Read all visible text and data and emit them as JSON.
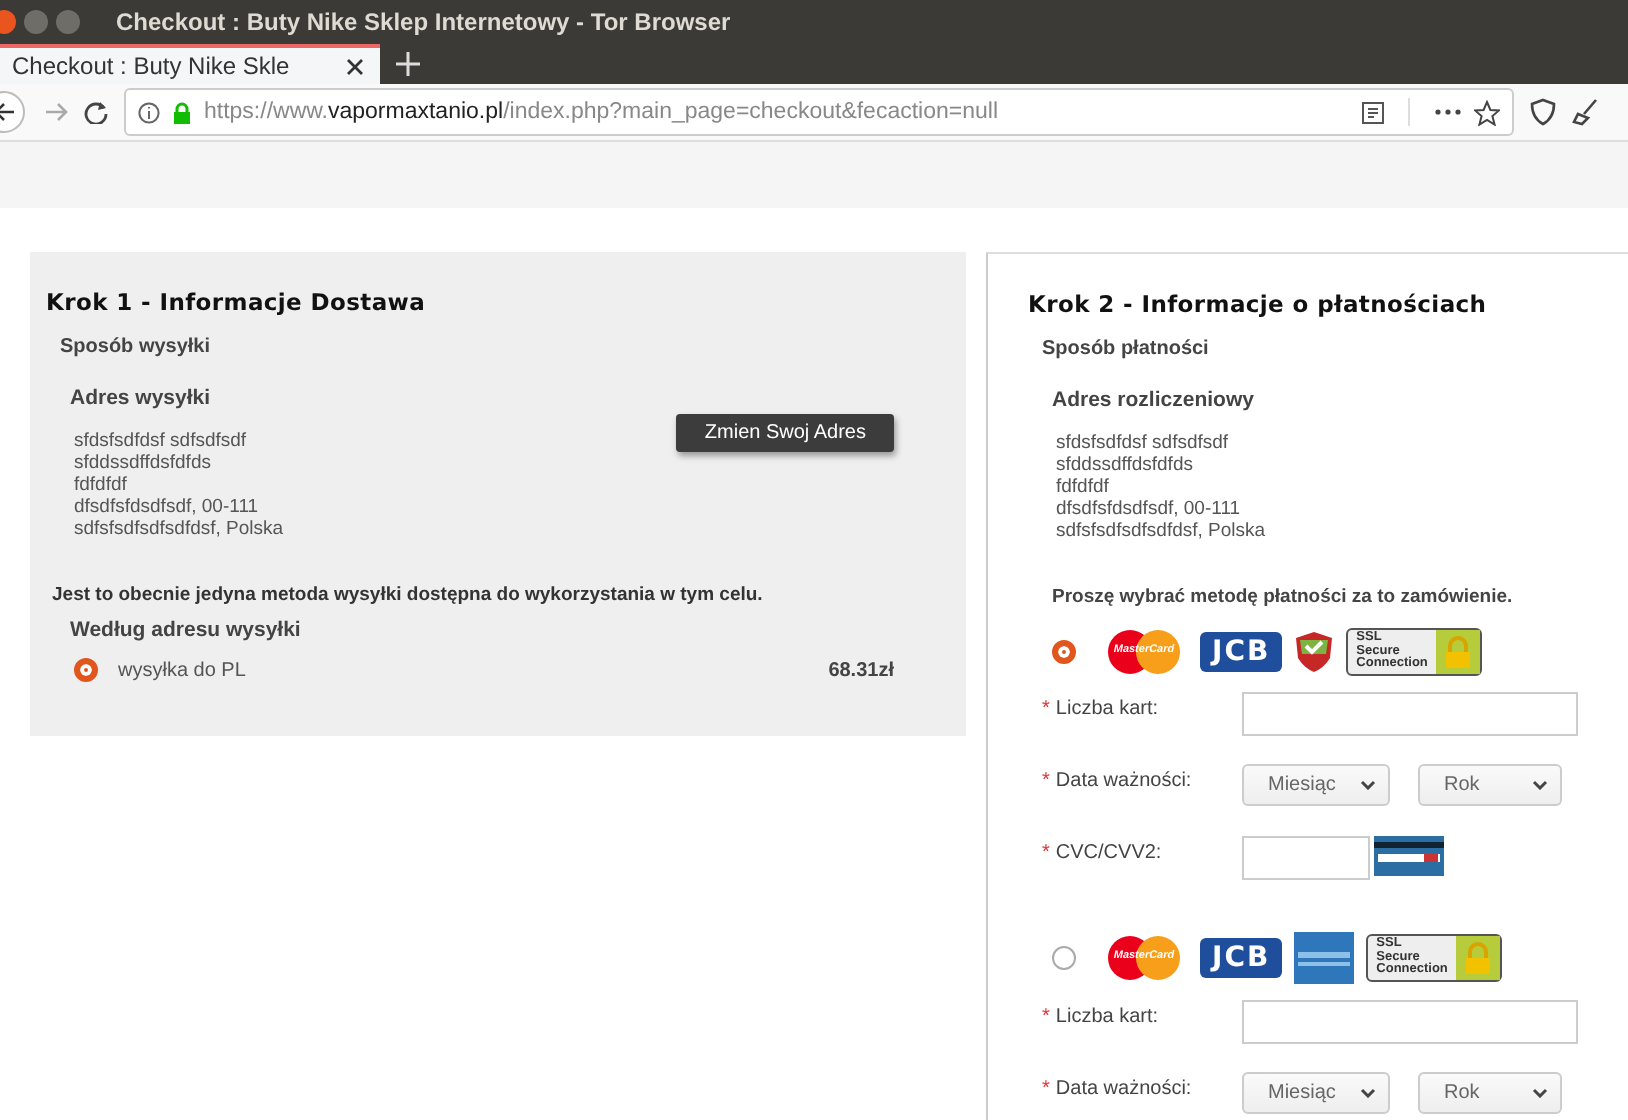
{
  "window": {
    "title": "Checkout : Buty Nike Sklep Internetowy - Tor Browser"
  },
  "tabs": [
    {
      "label": "Checkout : Buty Nike Skle",
      "selected": true
    }
  ],
  "address_bar": {
    "scheme": "https://www.",
    "domain": "vapormaxtanio.pl",
    "path": "/index.php?main_page=checkout&fecaction=null"
  },
  "shipping": {
    "heading": "Krok 1 - Informacje Dostawa",
    "method_label": "Sposób wysyłki",
    "address_heading": "Adres wysyłki",
    "address_lines": [
      "sfdsfsdfdsf sdfsdfsdf",
      "sfddssdffdsfdfds",
      "fdfdfdf",
      "dfsdfsfdsdfsdf, 00-111",
      "sdfsfsdfsdfsdfdsf, Polska"
    ],
    "change_button": "Zmien Swoj Adres",
    "note": "Jest to obecnie jedyna metoda wysyłki dostępna do wykorzystania w tym celu.",
    "rule_heading": "Według adresu wysyłki",
    "options": [
      {
        "label": "wysyłka do PL",
        "price": "68.31zł",
        "selected": true
      }
    ]
  },
  "payment": {
    "heading": "Krok 2 - Informacje o płatnościach",
    "method_label": "Sposób płatności",
    "address_heading": "Adres rozliczeniowy",
    "address_lines": [
      "sfdsfsdfdsf sdfsdfsdf",
      "sfddssdffdsfdfds",
      "fdfdfdf",
      "dfsdfsfdsdfsdf, 00-111",
      "sdfsfsdfsdfsdfdsf, Polska"
    ],
    "prompt": "Proszę wybrać metodę płatności za to zamówienie.",
    "methods": [
      {
        "selected": true,
        "logos": [
          {
            "kind": "mastercard",
            "text": "MasterCard"
          },
          {
            "kind": "jcb",
            "text": "JCB"
          },
          {
            "kind": "shield"
          },
          {
            "kind": "ssl",
            "lines": [
              "SSL",
              "Secure",
              "Connection"
            ]
          }
        ],
        "fields": [
          {
            "kind": "text",
            "mark": "*",
            "label": "Liczba kart:"
          },
          {
            "kind": "date",
            "mark": "*",
            "label": "Data ważności:",
            "selects": [
              "Miesiąc",
              "Rok"
            ]
          },
          {
            "kind": "cvc",
            "mark": "*",
            "label": "CVC/CVV2:"
          }
        ]
      },
      {
        "selected": false,
        "logos": [
          {
            "kind": "mastercard",
            "text": "MasterCard"
          },
          {
            "kind": "jcb",
            "text": "JCB"
          },
          {
            "kind": "amex"
          },
          {
            "kind": "ssl",
            "lines": [
              "SSL",
              "Secure",
              "Connection"
            ]
          }
        ],
        "fields": [
          {
            "kind": "text",
            "mark": "*",
            "label": "Liczba kart:"
          },
          {
            "kind": "date",
            "mark": "*",
            "label": "Data ważności:",
            "selects": [
              "Miesiąc",
              "Rok"
            ]
          }
        ]
      }
    ]
  }
}
